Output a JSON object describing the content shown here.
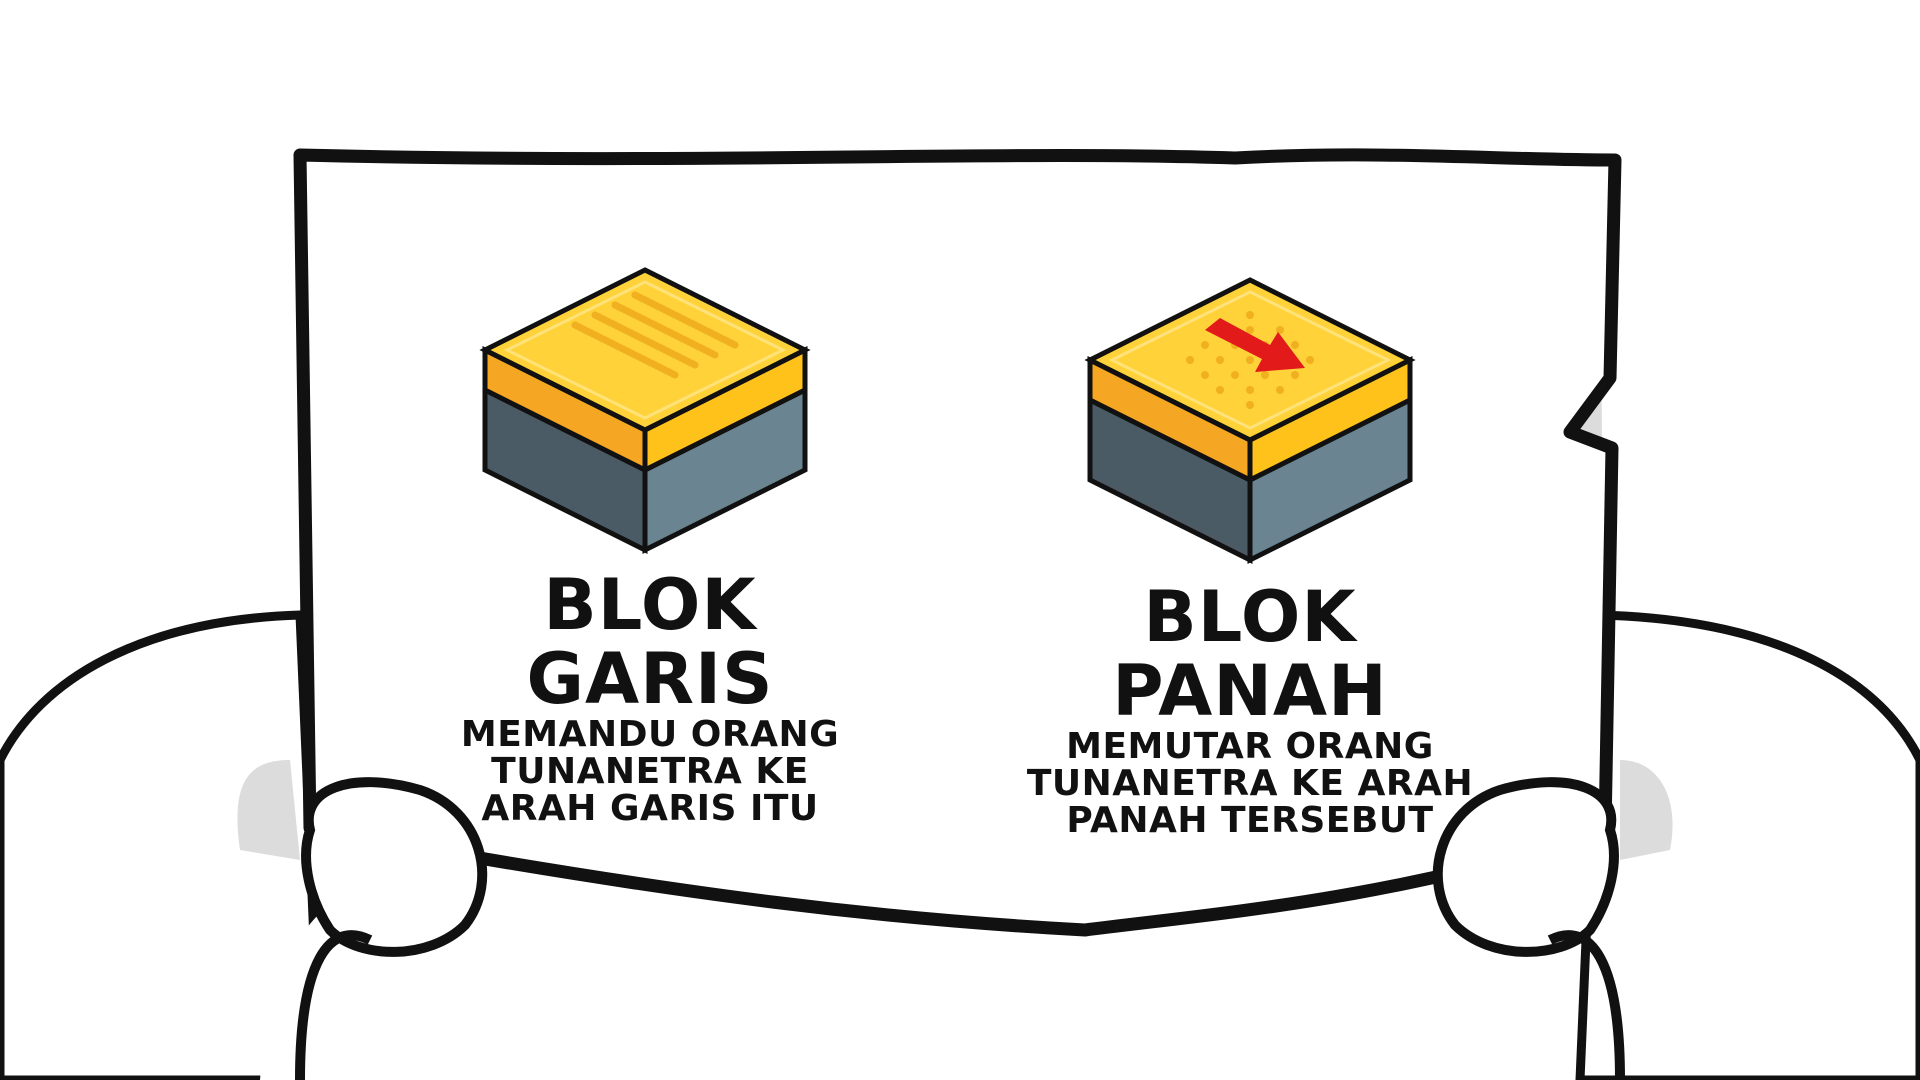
{
  "blocks": [
    {
      "title": "BLOK GARIS",
      "description": "MEMANDU ORANG\nTUNANETRA KE\nARAH GARIS ITU",
      "tile_pattern": "lines"
    },
    {
      "title": "BLOK PANAH",
      "description": "MEMUTAR ORANG\nTUNANETRA KE ARAH\nPANAH TERSEBUT",
      "tile_pattern": "dots-with-arrow"
    }
  ],
  "colors": {
    "tile_top": "#FFD23A",
    "tile_top_light": "#FFE27A",
    "tile_rim": "#F5A623",
    "base_left": "#4A5B66",
    "base_right": "#6A8491",
    "arrow": "#E21A1A",
    "outline": "#111111",
    "paper": "#FFFFFF",
    "shadow": "#DCDCDC"
  }
}
